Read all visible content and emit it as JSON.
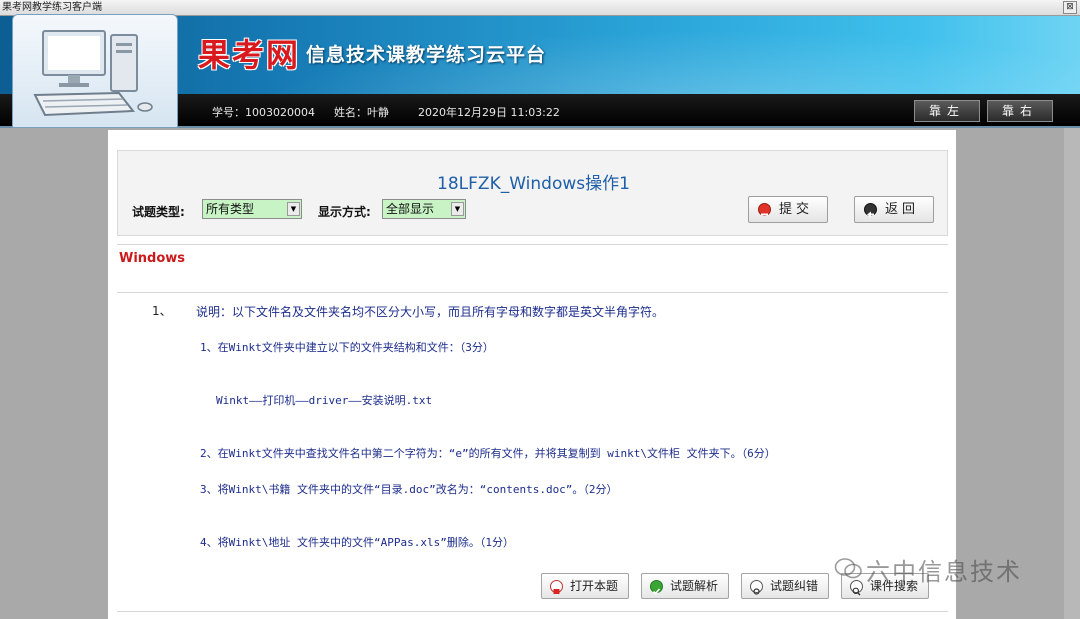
{
  "window": {
    "title": "果考网教学练习客户端",
    "close_glyph": "⊠"
  },
  "header": {
    "brand": "果考网",
    "subtitle": "信息技术课教学练习云平台",
    "student_id": "学号：1003020004",
    "name": "姓名：叶静",
    "datetime": "2020年12月29日 11:03:22",
    "btn_left": "靠左",
    "btn_right": "靠右"
  },
  "exam": {
    "title": "18LFZK_Windows操作1",
    "type_label": "试题类型:",
    "type_value": "所有类型",
    "display_label": "显示方式:",
    "display_value": "全部显示",
    "submit": "提交",
    "back": "返回"
  },
  "section": {
    "title": "Windows"
  },
  "question": {
    "number": "1、",
    "intro": "说明：以下文件名及文件夹名均不区分大小写，而且所有字母和数字都是英文半角字符。",
    "lines": [
      "1、在Winkt文件夹中建立以下的文件夹结构和文件：（3分）",
      "Winkt——打印机——driver——安装说明.txt",
      "2、在Winkt文件夹中查找文件名中第二个字符为：“e”的所有文件，并将其复制到 winkt\\文件柜 文件夹下。（6分）",
      "3、将Winkt\\书籍 文件夹中的文件“目录.doc”改名为：“contents.doc”。（2分）",
      "4、将Winkt\\地址 文件夹中的文件“APPas.xls”删除。（1分）"
    ]
  },
  "tools": {
    "open": "打开本题",
    "analysis": "试题解析",
    "correct": "试题纠错",
    "search": "课件搜索"
  },
  "watermark": "六中信息技术",
  "colors": {
    "brand_red": "#d8191d",
    "title_blue": "#1f5fa8",
    "section_red": "#cc1a1a",
    "select_green": "#c8f3c5"
  }
}
